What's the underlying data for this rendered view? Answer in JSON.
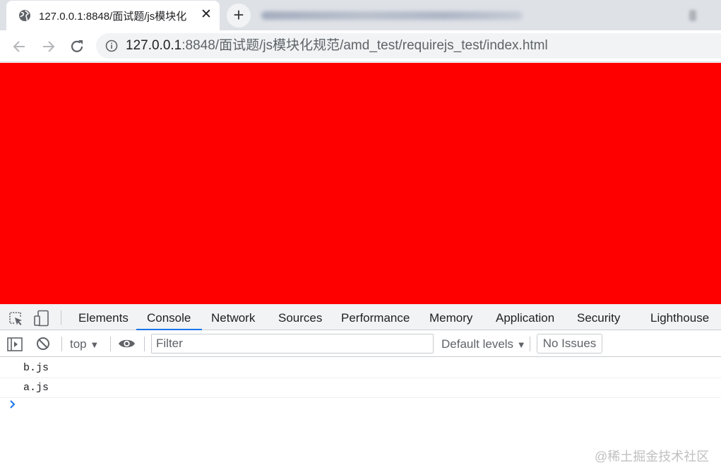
{
  "browser": {
    "tab": {
      "title": "127.0.0.1:8848/面试题/js模块化",
      "close_glyph": "✕"
    },
    "new_tab_glyph": "+",
    "address": {
      "host": "127.0.0.1",
      "rest": ":8848/面试题/js模块化规范/amd_test/requirejs_test/index.html"
    }
  },
  "page": {
    "background": "#ff0000"
  },
  "devtools": {
    "tabs": [
      {
        "label": "Elements"
      },
      {
        "label": "Console",
        "active": true
      },
      {
        "label": "Network"
      },
      {
        "label": "Sources"
      },
      {
        "label": "Performance"
      },
      {
        "label": "Memory"
      },
      {
        "label": "Application"
      },
      {
        "label": "Security"
      },
      {
        "label": "Lighthouse"
      }
    ],
    "filterbar": {
      "context": "top",
      "filter_placeholder": "Filter",
      "levels": "Default levels",
      "issues": "No Issues",
      "dropdown_glyph": "▼"
    },
    "console_lines": [
      "b.js",
      "a.js"
    ],
    "accent": "#1a73e8"
  },
  "watermark": "@稀土掘金技术社区"
}
